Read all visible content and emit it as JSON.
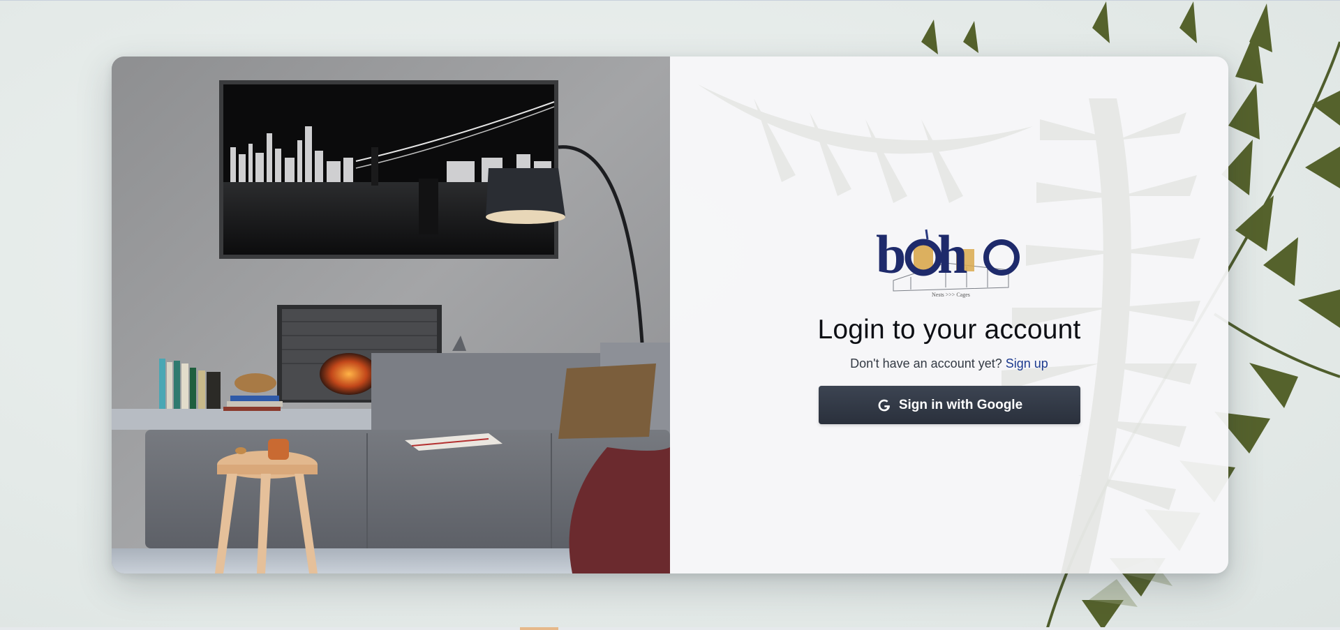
{
  "login": {
    "title": "Login to your account",
    "signup_prompt": "Don't have an account yet?",
    "signup_link": "Sign up",
    "google_button": "Sign in with Google"
  },
  "logo": {
    "wordmark": "boho",
    "tagline": "Nests >>> Cages"
  },
  "colors": {
    "button_bg": "#2f3542",
    "link": "#1d3b8f",
    "logo_navy": "#1e2a6b",
    "logo_gold": "#d9a94e"
  },
  "icons": {
    "google_button_icon": "google-g-icon"
  }
}
